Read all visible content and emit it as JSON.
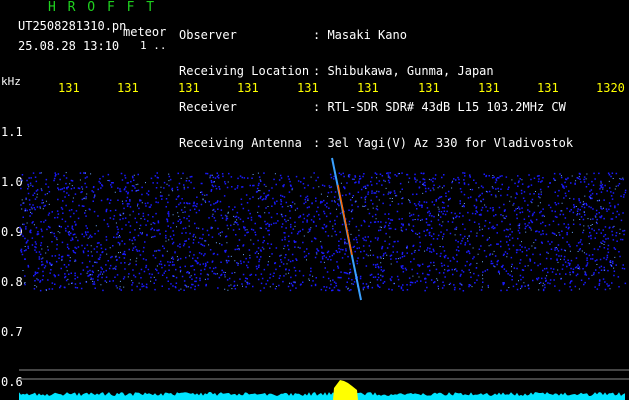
{
  "header": {
    "app_title": "H R O F F T",
    "file_name": "UT2508281310.pn",
    "mode": "meteor",
    "datetime": "25.08.28 13:10",
    "status_marker": "1 ..",
    "info": [
      {
        "label": "Observer",
        "value": "Masaki Kano"
      },
      {
        "label": "Receiving Location",
        "value": "Shibukawa, Gunma, Japan"
      },
      {
        "label": "Receiver",
        "value": "RTL-SDR SDR# 43dB L15 103.2MHz CW"
      },
      {
        "label": "Receiving Antenna",
        "value": "3el Yagi(V) Az 330 for Vladivostok"
      }
    ]
  },
  "axes": {
    "y_unit": "kHz",
    "y_ticks": [
      "1.1",
      "1.0",
      "0.9",
      "0.8",
      "0.7",
      "0.6"
    ],
    "x_ticks": [
      "131",
      "131",
      "131",
      "131",
      "131",
      "131",
      "131",
      "131",
      "131",
      "1320"
    ]
  },
  "colors": {
    "header_title": "#1fd11f",
    "header_text": "#ffffff",
    "tick_labels_x": "#ffff00",
    "noise_band": "#1a1aff",
    "meteor_trail": "#ff6600",
    "baseline_signal": "#00e5ff",
    "spike": "#ffff00",
    "reference_lines": "#8a8a8a"
  }
}
